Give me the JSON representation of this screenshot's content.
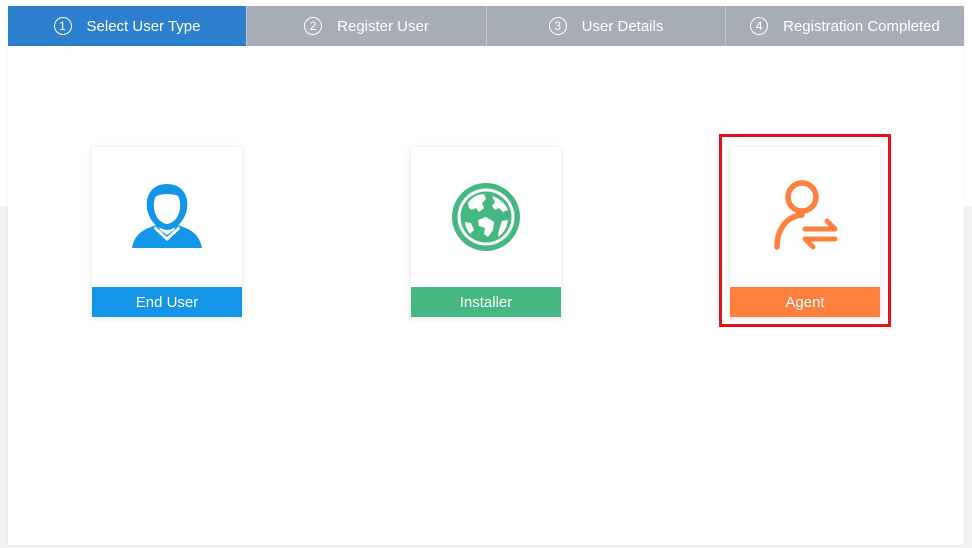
{
  "steps": [
    {
      "num": "1",
      "label": "Select User Type"
    },
    {
      "num": "2",
      "label": "Register User"
    },
    {
      "num": "3",
      "label": "User Details"
    },
    {
      "num": "4",
      "label": "Registration Completed"
    }
  ],
  "cards": [
    {
      "label": "End User",
      "icon": "user-icon",
      "color": "#1396e8"
    },
    {
      "label": "Installer",
      "icon": "globe-icon",
      "color": "#45b882"
    },
    {
      "label": "Agent",
      "icon": "agent-exchange-icon",
      "color": "#ff7f3f"
    }
  ],
  "colors": {
    "step_active": "#2c80cd",
    "step_inactive": "#a7adb6",
    "highlight": "#e61217"
  }
}
